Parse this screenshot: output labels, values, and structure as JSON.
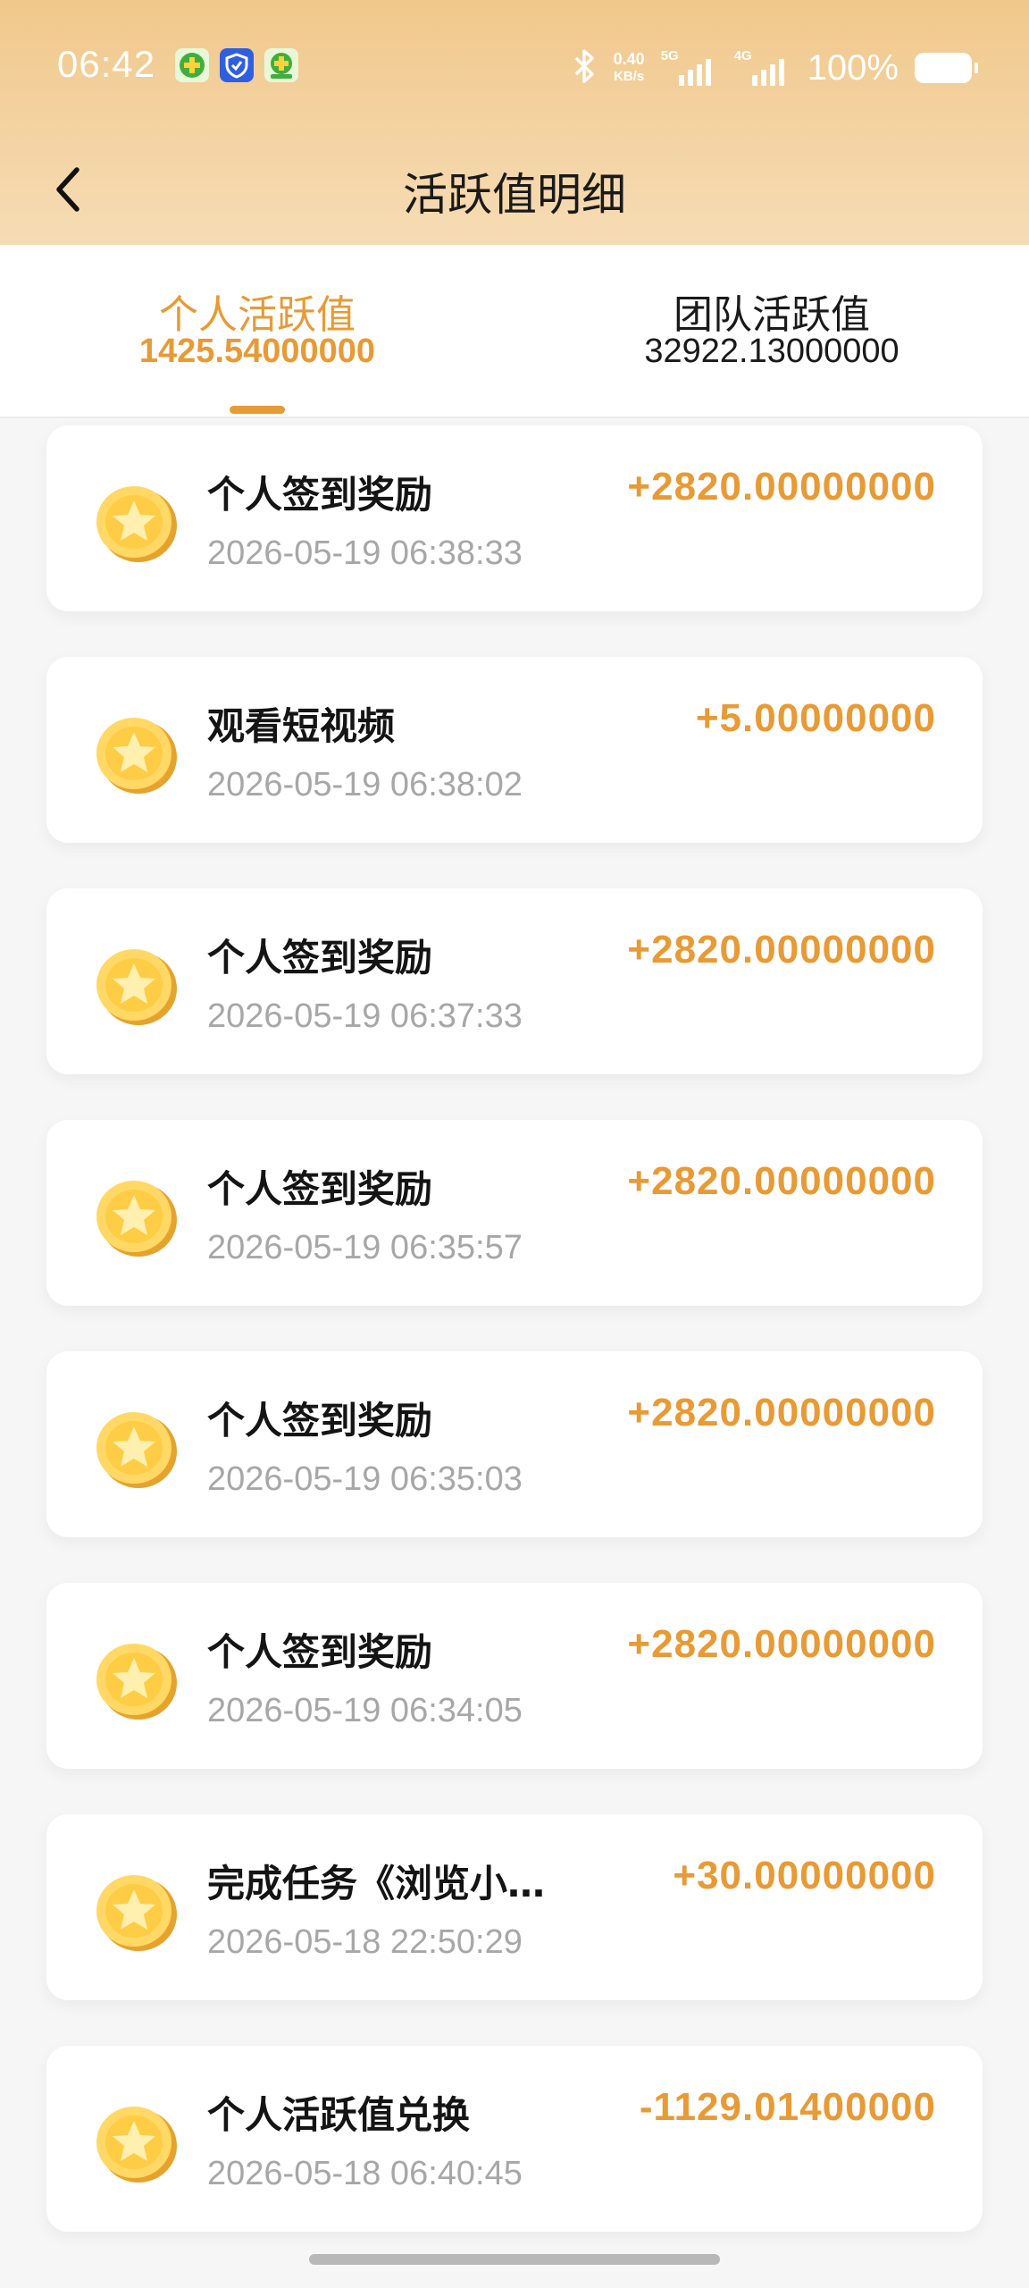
{
  "status_bar": {
    "time": "06:42",
    "net_speed_value": "0.40",
    "net_speed_unit": "KB/s",
    "signal_1_label": "5G",
    "signal_2_label": "4G",
    "battery_percent": "100%"
  },
  "header": {
    "title": "活跃值明细"
  },
  "tabs": [
    {
      "label": "个人活跃值",
      "value": "1425.54000000",
      "active": true
    },
    {
      "label": "团队活跃值",
      "value": "32922.13000000",
      "active": false
    }
  ],
  "records": [
    {
      "title": "个人签到奖励",
      "time": "2026-05-19 06:38:33",
      "amount": "+2820.00000000"
    },
    {
      "title": "观看短视频",
      "time": "2026-05-19 06:38:02",
      "amount": "+5.00000000"
    },
    {
      "title": "个人签到奖励",
      "time": "2026-05-19 06:37:33",
      "amount": "+2820.00000000"
    },
    {
      "title": "个人签到奖励",
      "time": "2026-05-19 06:35:57",
      "amount": "+2820.00000000"
    },
    {
      "title": "个人签到奖励",
      "time": "2026-05-19 06:35:03",
      "amount": "+2820.00000000"
    },
    {
      "title": "个人签到奖励",
      "time": "2026-05-19 06:34:05",
      "amount": "+2820.00000000"
    },
    {
      "title": "完成任务《浏览小…",
      "time": "2026-05-18 22:50:29",
      "amount": "+30.00000000"
    },
    {
      "title": "个人活跃值兑换",
      "time": "2026-05-18 06:40:45",
      "amount": "-1129.01400000"
    }
  ],
  "colors": {
    "accent": "#e89a35",
    "header_gradient_top": "#f0c88b",
    "header_gradient_bottom": "#f6dcb4",
    "muted_text": "#a7a7a7"
  },
  "icons": {
    "back": "back-arrow-icon",
    "coin": "gold-coin-star-icon",
    "bluetooth": "bluetooth-icon",
    "signal": "cellular-signal-icon",
    "battery": "battery-icon"
  }
}
